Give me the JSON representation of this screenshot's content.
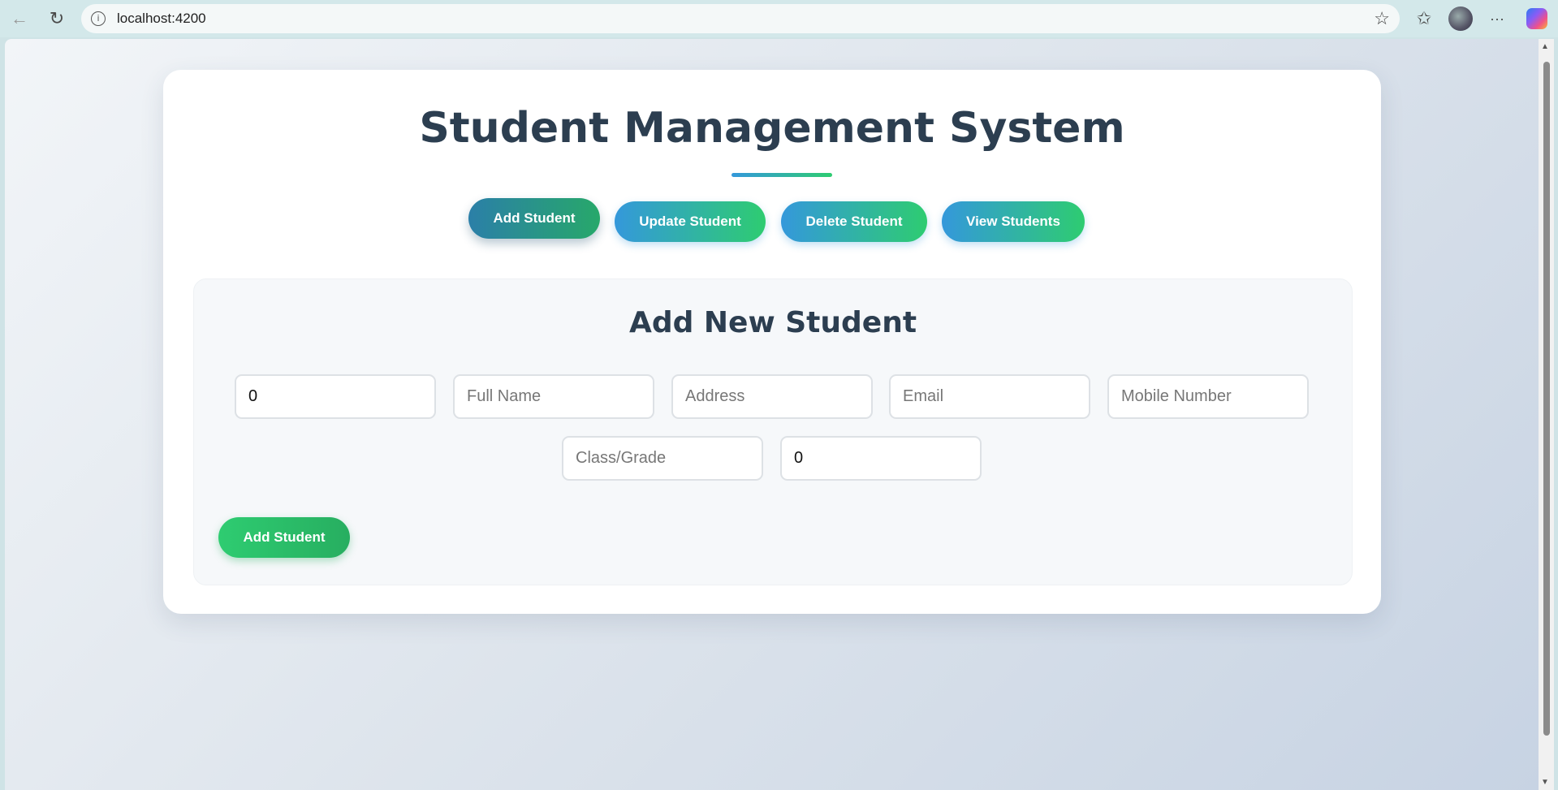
{
  "browser": {
    "url": "localhost:4200",
    "back_icon": "back-arrow-icon",
    "reload_icon": "reload-icon",
    "info_icon": "info-icon",
    "star_icon": "star-icon",
    "favorites_icon": "favorites-icon",
    "more_icon": "more-icon",
    "more_label": "···"
  },
  "header": {
    "title": "Student Management System"
  },
  "nav": {
    "buttons": [
      {
        "label": "Add Student",
        "active": true
      },
      {
        "label": "Update Student",
        "active": false
      },
      {
        "label": "Delete Student",
        "active": false
      },
      {
        "label": "View Students",
        "active": false
      }
    ]
  },
  "form": {
    "title": "Add New Student",
    "fields": {
      "id": {
        "value": "0",
        "placeholder": ""
      },
      "full_name": {
        "value": "",
        "placeholder": "Full Name"
      },
      "address": {
        "value": "",
        "placeholder": "Address"
      },
      "email": {
        "value": "",
        "placeholder": "Email"
      },
      "mobile": {
        "value": "",
        "placeholder": "Mobile Number"
      },
      "class_grade": {
        "value": "",
        "placeholder": "Class/Grade"
      },
      "extra_number": {
        "value": "0",
        "placeholder": ""
      }
    },
    "submit_label": "Add Student"
  },
  "colors": {
    "title": "#2c3e50",
    "gradient_start": "#3498db",
    "gradient_end": "#2ecc71",
    "submit": "#2ecc71"
  }
}
